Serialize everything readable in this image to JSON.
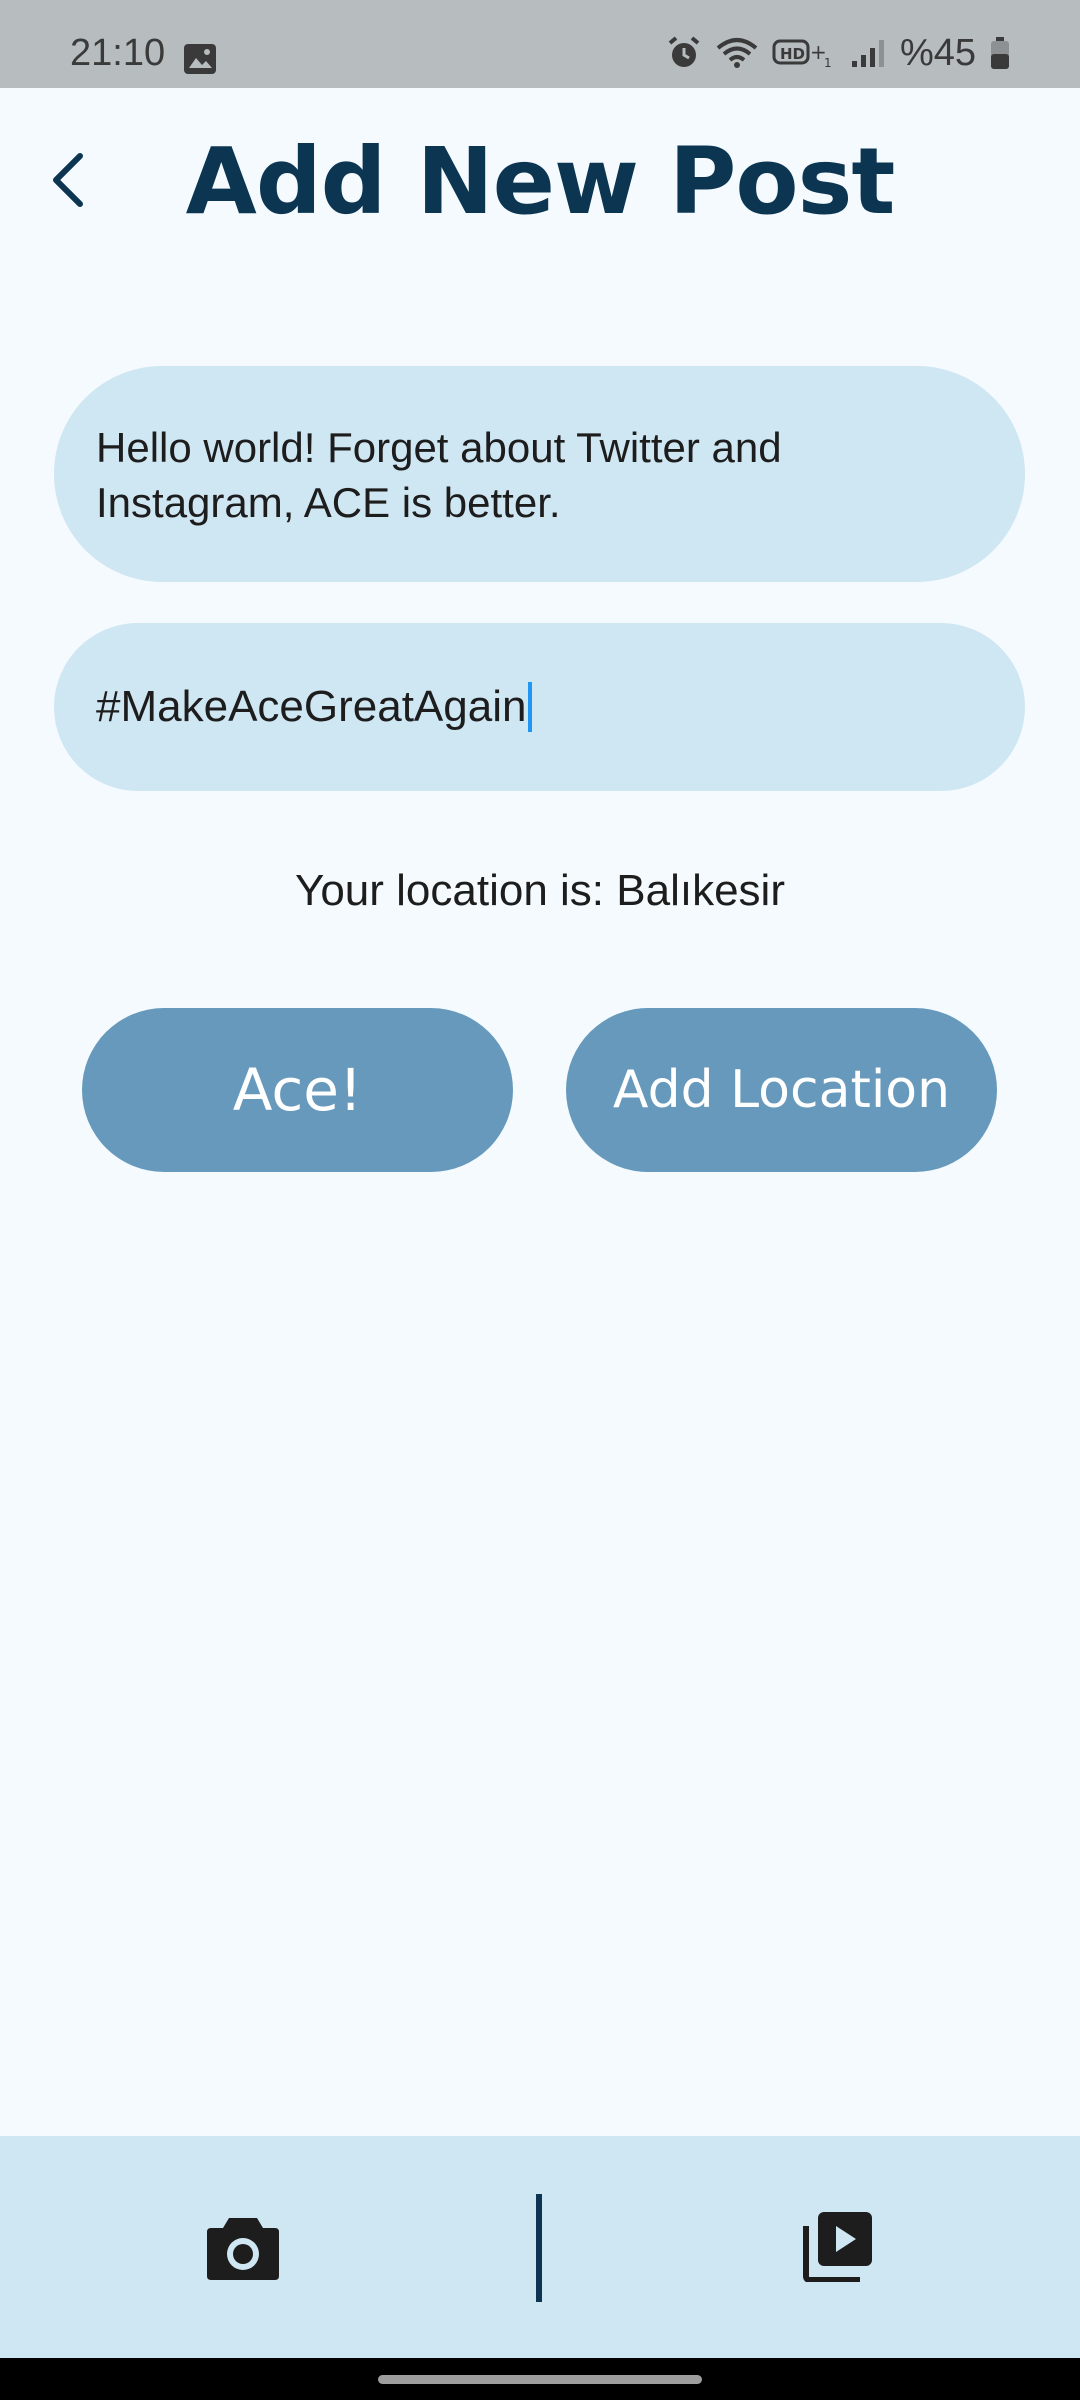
{
  "status_bar": {
    "time": "21:10",
    "battery_text": "%45",
    "icons": [
      "gallery-icon",
      "alarm-icon",
      "wifi-icon",
      "hd-voice-icon",
      "signal-icon",
      "battery-icon"
    ]
  },
  "header": {
    "title": "Add New Post",
    "back_icon": "chevron-left-icon"
  },
  "post_input": {
    "value": "Hello world! Forget about Twitter and Instagram, ACE is better."
  },
  "tag_input": {
    "value": "#MakeAceGreatAgain"
  },
  "location_text": "Your location is: Balıkesir",
  "buttons": {
    "ace_label": "Ace!",
    "add_location_label": "Add Location"
  },
  "bottom_bar": {
    "left_icon": "camera-icon",
    "right_icon": "video-library-icon"
  },
  "colors": {
    "background": "#f4fafd",
    "field": "#cfe6f3",
    "button": "#6699bb",
    "title": "#0c3552",
    "caret": "#2196f3"
  }
}
